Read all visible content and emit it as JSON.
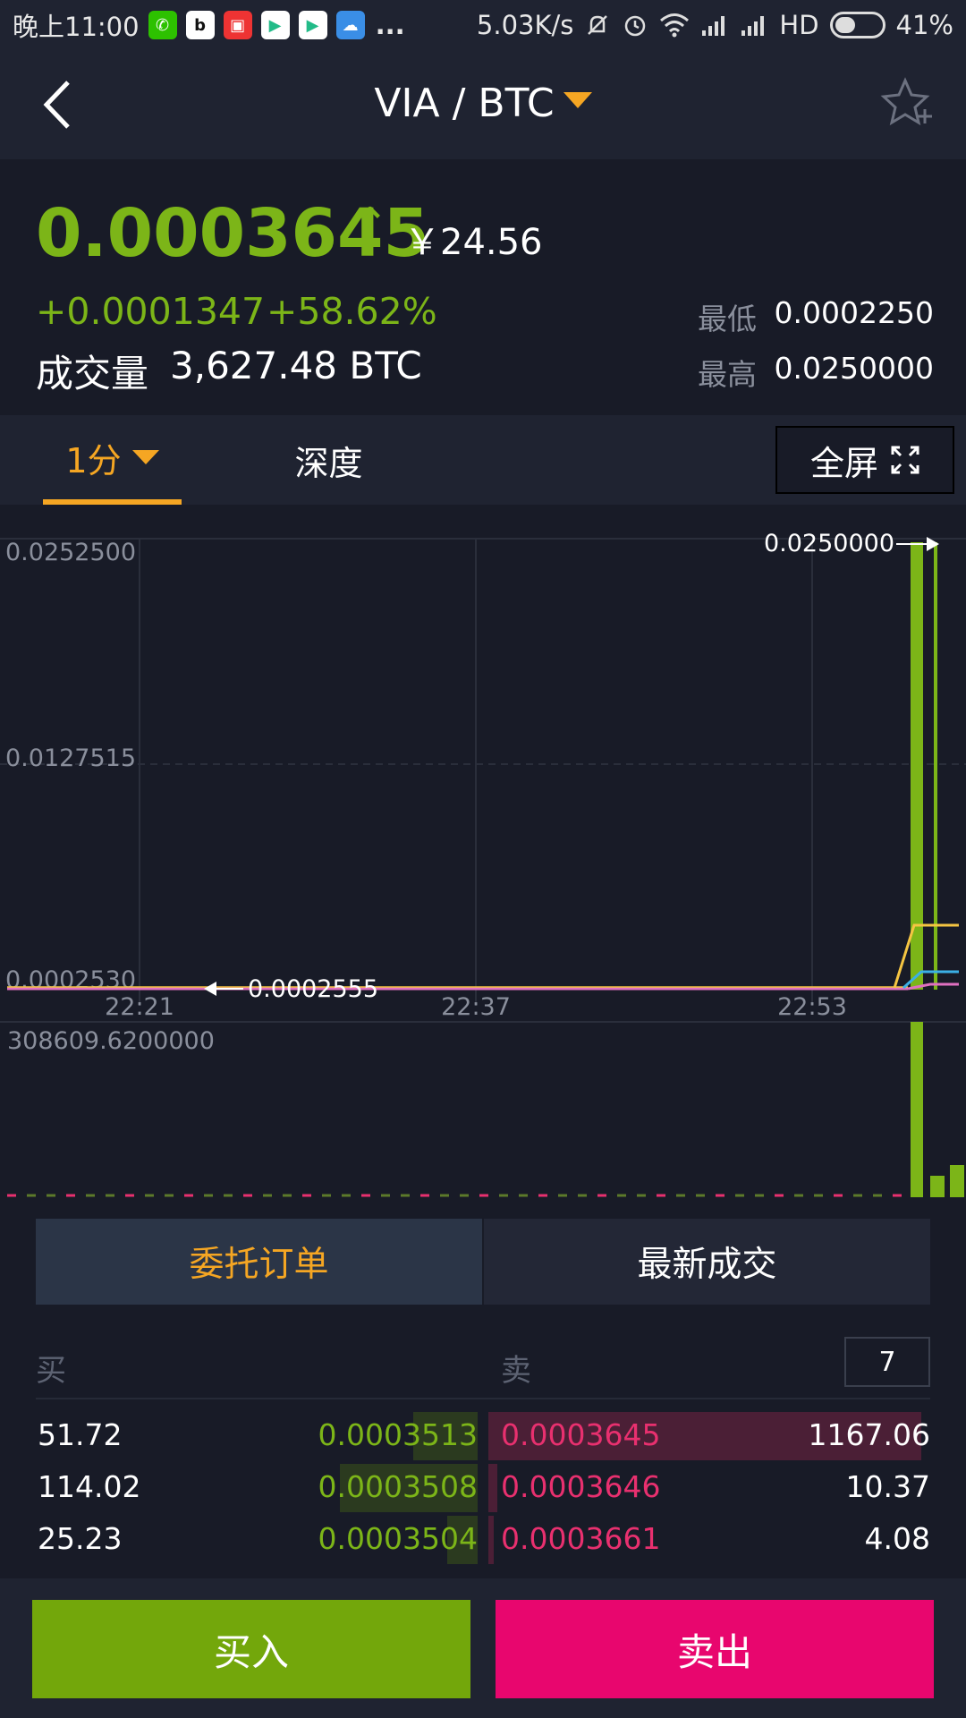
{
  "status_bar": {
    "time": "晚上11:00",
    "network_speed": "5.03K/s",
    "network_type": "HD",
    "battery": "41%",
    "more": "..."
  },
  "nav": {
    "title": "VIA / BTC"
  },
  "ticker": {
    "last_price": "0.0003645",
    "cny_price": "￥24.56",
    "change_abs": "+0.0001347",
    "change_pct": "+58.62%",
    "volume_label": "成交量",
    "volume_value": "3,627.48 BTC",
    "low_label": "最低",
    "low_value": "0.0002250",
    "high_label": "最高",
    "high_value": "0.0250000"
  },
  "tabs": {
    "interval": "1分",
    "depth": "深度",
    "fullscreen": "全屏"
  },
  "chart_data": {
    "type": "candlestick",
    "y_ticks": [
      "0.0252500",
      "0.0127515",
      "0.0002530"
    ],
    "x_ticks": [
      "22:21",
      "22:37",
      "22:53"
    ],
    "ylim": [
      0.000253,
      0.02525
    ],
    "max_marker": "0.0250000",
    "min_marker": "0.0002555",
    "volume_max_label": "308609.6200000",
    "colors": {
      "up": "#7cb518",
      "down": "#e8306f",
      "ma_yellow": "#f5c542",
      "ma_blue": "#3bb0e6",
      "ma_pink": "#e070c0"
    }
  },
  "order_tabs": {
    "orders": "委托订单",
    "trades": "最新成交"
  },
  "book": {
    "buy_label": "买",
    "sell_label": "卖",
    "depth": "7",
    "rows": [
      {
        "bid_qty": "51.72",
        "bid_price": "0.0003513",
        "ask_price": "0.0003645",
        "ask_qty": "1167.06",
        "bid_fill": 0.15,
        "ask_fill": 0.98
      },
      {
        "bid_qty": "114.02",
        "bid_price": "0.0003508",
        "ask_price": "0.0003646",
        "ask_qty": "10.37",
        "bid_fill": 0.32,
        "ask_fill": 0.02
      },
      {
        "bid_qty": "25.23",
        "bid_price": "0.0003504",
        "ask_price": "0.0003661",
        "ask_qty": "4.08",
        "bid_fill": 0.07,
        "ask_fill": 0.01
      }
    ]
  },
  "actions": {
    "buy": "买入",
    "sell": "卖出"
  }
}
